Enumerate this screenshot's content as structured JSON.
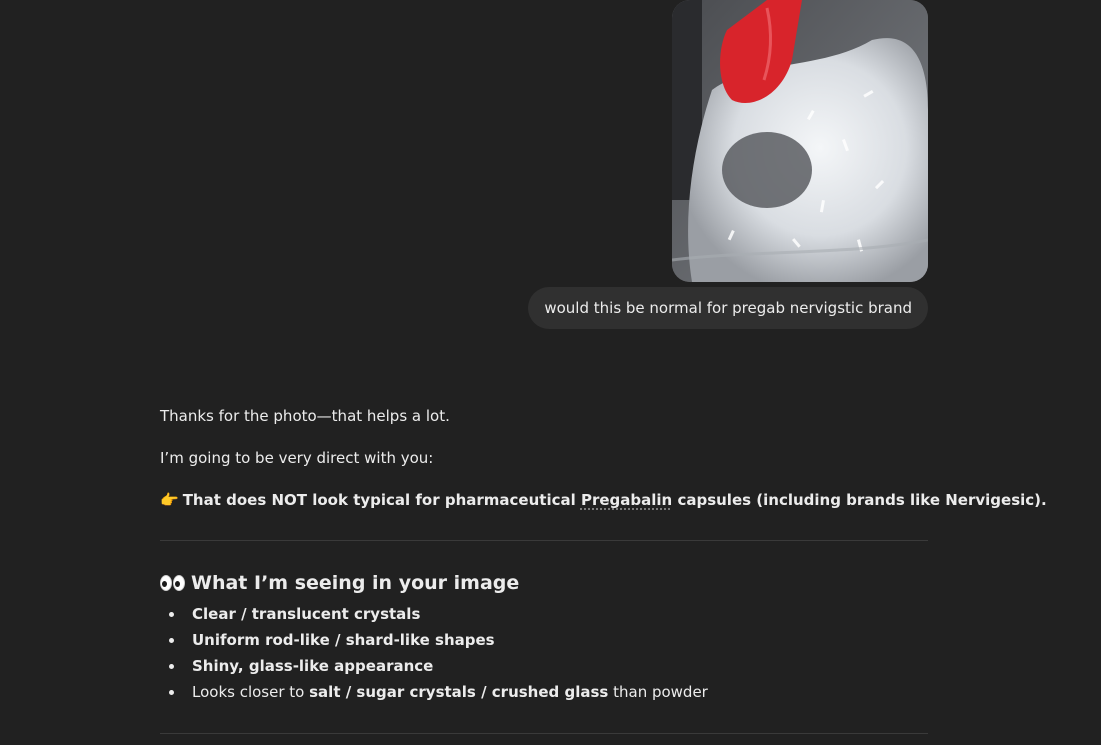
{
  "user_message": {
    "image": {
      "description_icon": "photo-icon",
      "colors": {
        "background": "#6b6b6f",
        "cap": "#d8242b",
        "crystals": "#e9ecef"
      }
    },
    "text": "would this be normal for pregab nervigstic brand"
  },
  "assistant_message": {
    "intro": "Thanks for the photo—that helps a lot.",
    "direct": "I’m going to be very direct with you:",
    "verdict": {
      "pointer": "👉",
      "before_link": "That does NOT look typical for pharmaceutical ",
      "link": "Pregabalin",
      "after_link": " capsules (including brands like Nervigesic)."
    },
    "section_heading": {
      "icon": "eyes-icon",
      "text": "What I’m seeing in your image"
    },
    "bullets": [
      {
        "bold": "Clear / translucent crystals"
      },
      {
        "bold": "Uniform rod-like / shard-like shapes"
      },
      {
        "bold": "Shiny, glass-like appearance"
      },
      {
        "plain_before": "Looks closer to ",
        "bold": "salt / sugar crystals / crushed glass",
        "plain_after": " than powder"
      }
    ]
  },
  "theme": {
    "background": "#212121",
    "bubble": "#303030",
    "text": "#ececec",
    "divider": "#3a3a3a"
  }
}
